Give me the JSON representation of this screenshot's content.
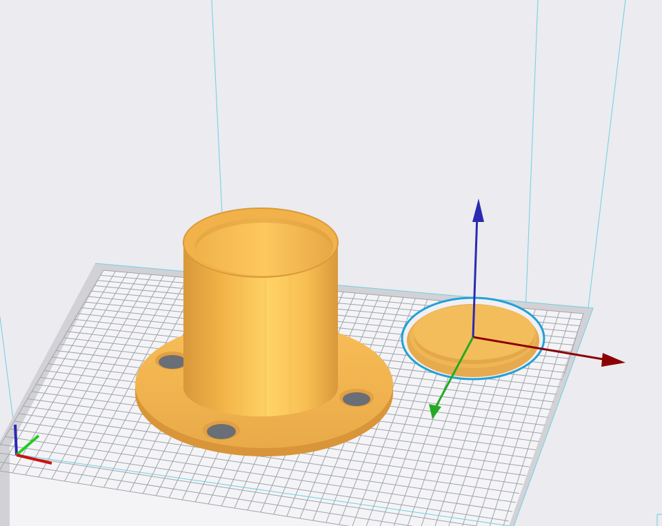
{
  "viewport": {
    "background": "#ebebf0",
    "mode": "3d-print-preparation"
  },
  "colors": {
    "model": "#f7b84a",
    "model_shade": "#e5a340",
    "model_highlight": "#ffd36a",
    "selection_outline": "#22a0d8",
    "build_volume_edge": "#6ecfe0",
    "plate_fill": "#f4f4f6",
    "plate_border": "#d4d4d8",
    "grid_line": "#9fa3ad",
    "axis_x": "#8b0000",
    "axis_y": "#22aa22",
    "axis_z": "#2a2ab0"
  },
  "objects": [
    {
      "name": "flange-tube",
      "selected": false
    },
    {
      "name": "cap-disc",
      "selected": true
    }
  ],
  "gizmo": {
    "axes": [
      "x",
      "y",
      "z"
    ]
  },
  "icons": {
    "corner_axes": "axes-indicator-icon",
    "move_gizmo": "move-gizmo-icon"
  }
}
